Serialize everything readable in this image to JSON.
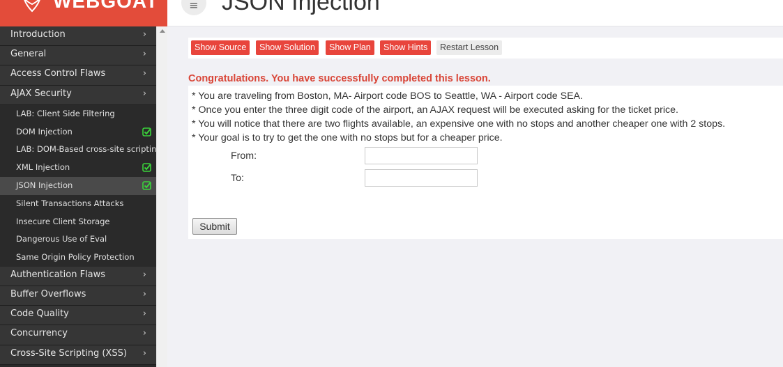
{
  "brand": {
    "name": "WEBGOAT"
  },
  "header": {
    "menu_icon": "≡",
    "title": "JSON Injection"
  },
  "sidebar": {
    "chevron": "›",
    "categories_top": [
      {
        "label": "Introduction"
      },
      {
        "label": "General"
      },
      {
        "label": "Access Control Flaws"
      },
      {
        "label": "AJAX Security"
      }
    ],
    "lessons": [
      {
        "label": "LAB: Client Side Filtering",
        "completed": false,
        "active": false
      },
      {
        "label": "DOM Injection",
        "completed": true,
        "active": false
      },
      {
        "label": "LAB: DOM-Based cross-site scripting",
        "completed": false,
        "active": false
      },
      {
        "label": "XML Injection",
        "completed": true,
        "active": false
      },
      {
        "label": "JSON Injection",
        "completed": true,
        "active": true
      },
      {
        "label": "Silent Transactions Attacks",
        "completed": false,
        "active": false
      },
      {
        "label": "Insecure Client Storage",
        "completed": false,
        "active": false
      },
      {
        "label": "Dangerous Use of Eval",
        "completed": false,
        "active": false
      },
      {
        "label": "Same Origin Policy Protection",
        "completed": false,
        "active": false
      }
    ],
    "categories_bottom": [
      {
        "label": "Authentication Flaws"
      },
      {
        "label": "Buffer Overflows"
      },
      {
        "label": "Code Quality"
      },
      {
        "label": "Concurrency"
      },
      {
        "label": "Cross-Site Scripting (XSS)"
      }
    ]
  },
  "toolbar": {
    "show_source": "Show Source",
    "show_solution": "Show Solution",
    "show_plan": "Show Plan",
    "show_hints": "Show Hints",
    "restart_lesson": "Restart Lesson"
  },
  "lesson": {
    "congrats": "Congratulations. You have successfully completed this lesson.",
    "instructions": [
      "* You are traveling from Boston, MA- Airport code BOS to Seattle, WA - Airport code SEA.",
      "* Once you enter the three digit code of the airport, an AJAX request will be executed asking for the ticket price.",
      "* You will notice that there are two flights available, an expensive one with no stops and another cheaper one with 2 stops.",
      "* Your goal is to try to get the one with no stops but for a cheaper price."
    ],
    "from_label": "From:",
    "from_value": "",
    "to_label": "To:",
    "to_value": "",
    "submit_label": "Submit"
  },
  "colors": {
    "accent": "#e34c3a",
    "button_red": "#e8453c",
    "sidebar_bg": "#2a2a2a",
    "check_green": "#3ad23a"
  }
}
